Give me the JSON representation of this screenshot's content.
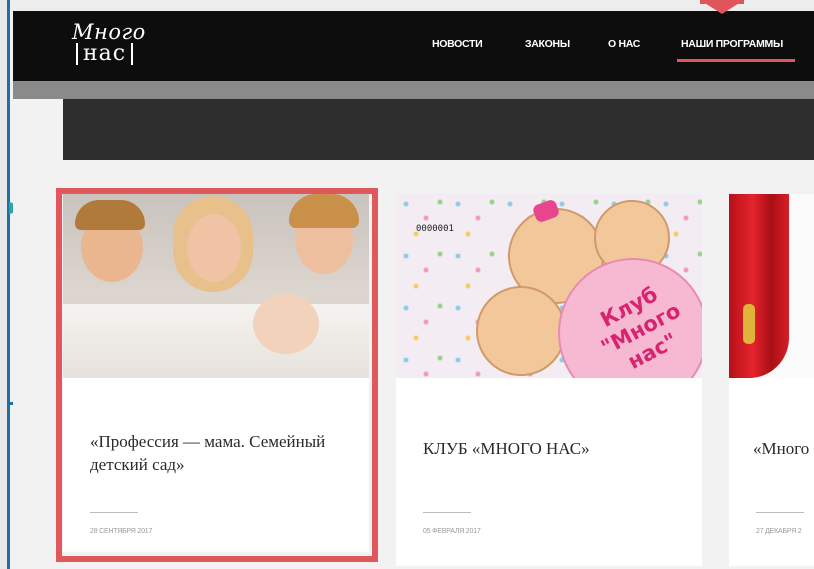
{
  "brand": {
    "logo_line1": "Много",
    "logo_line2": "нас"
  },
  "nav": {
    "items": [
      {
        "label": "НОВОСТИ"
      },
      {
        "label": "ЗАКОНЫ"
      },
      {
        "label": "О НАС"
      },
      {
        "label": "НАШИ ПРОГРАММЫ"
      }
    ],
    "active_index": 3
  },
  "cards": [
    {
      "title": "«Профессия — мама. Семейный детский сад»",
      "date": "28 сентября 2017",
      "image": "family-photo",
      "highlighted": true
    },
    {
      "title": "КЛУБ «МНОГО НАС»",
      "date": "05 февраля 2017",
      "image": "club-illustration",
      "image_code": "0000001",
      "image_caption": "Клуб \"Много нас\""
    },
    {
      "title": "«Много",
      "date": "27 декабря 2",
      "image": "theater-curtain"
    }
  ],
  "colors": {
    "accent": "#e0555b",
    "header_bg": "#0d0d0d",
    "banner_bg": "#2e2e2e",
    "page_bg": "#f2f2f2"
  }
}
